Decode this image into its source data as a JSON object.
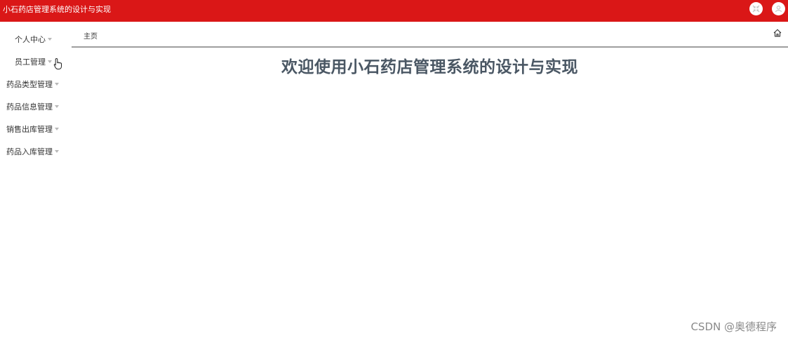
{
  "header": {
    "app_title": "小石药店管理系统的设计与实现",
    "background_color": "#da1717",
    "buttons": [
      {
        "icon": "shrink-icon"
      },
      {
        "icon": "user-icon"
      }
    ]
  },
  "sidebar": {
    "items": [
      {
        "label": "个人中心"
      },
      {
        "label": "员工管理"
      },
      {
        "label": "药品类型管理"
      },
      {
        "label": "药品信息管理"
      },
      {
        "label": "销售出库管理"
      },
      {
        "label": "药品入库管理"
      }
    ]
  },
  "breadcrumb": {
    "current": "主页",
    "home_icon": "home-icon"
  },
  "main": {
    "welcome_text": "欢迎使用小石药店管理系统的设计与实现"
  },
  "watermark": "CSDN @奥德程序"
}
